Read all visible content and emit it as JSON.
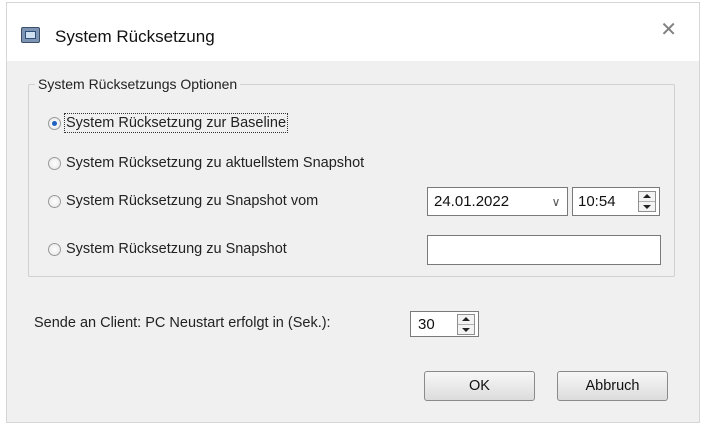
{
  "window": {
    "title": "System Rücksetzung",
    "close_glyph": "✕",
    "icon": "app-window-icon"
  },
  "options_group": {
    "legend": "System Rücksetzungs Optionen",
    "selected_index": 0,
    "options": [
      {
        "label": "System Rücksetzung zur Baseline"
      },
      {
        "label": "System Rücksetzung zu aktuellstem Snapshot"
      },
      {
        "label": "System Rücksetzung zu Snapshot vom"
      },
      {
        "label": "System Rücksetzung zu Snapshot"
      }
    ],
    "date_value": "24.01.2022",
    "date_chevron": "∨",
    "time_value": "10:54",
    "snapshot_value": ""
  },
  "restart": {
    "label": "Sende an Client: PC Neustart erfolgt in (Sek.):",
    "value": "30"
  },
  "buttons": {
    "ok": "OK",
    "cancel": "Abbruch"
  },
  "colors": {
    "dialog_bg": "#f0f0f0",
    "radio_selected": "#1f5fbf"
  }
}
